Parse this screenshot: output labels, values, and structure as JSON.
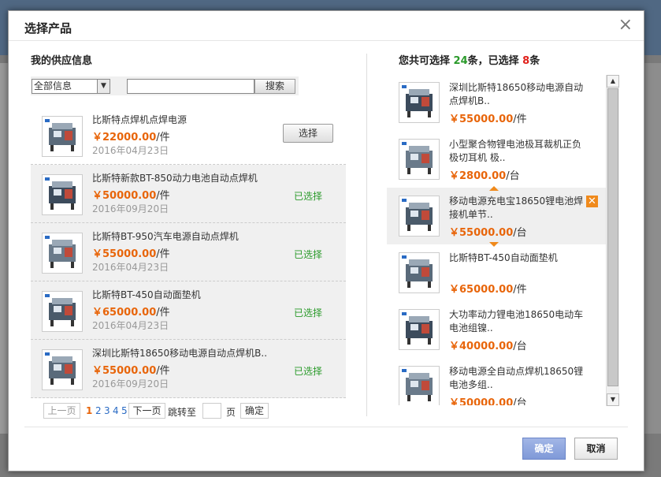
{
  "dialog": {
    "title": "选择产品",
    "close_icon": "close-icon"
  },
  "left": {
    "section_title": "我的供应信息",
    "filter": {
      "selected": "全部信息",
      "search_value": "",
      "search_button": "搜索"
    },
    "products": [
      {
        "name": "比斯特点焊机点焊电源",
        "currency": "￥",
        "price": "22000.00",
        "unit": "/件",
        "date": "2016年04月23日",
        "action": "选择",
        "selected": false
      },
      {
        "name": "比斯特新款BT-850动力电池自动点焊机",
        "currency": "￥",
        "price": "50000.00",
        "unit": "/件",
        "date": "2016年09月20日",
        "action": "已选择",
        "selected": true
      },
      {
        "name": "比斯特BT-950汽车电源自动点焊机",
        "currency": "￥",
        "price": "55000.00",
        "unit": "/件",
        "date": "2016年04月23日",
        "action": "已选择",
        "selected": true
      },
      {
        "name": "比斯特BT-450自动面垫机",
        "currency": "￥",
        "price": "65000.00",
        "unit": "/件",
        "date": "2016年04月23日",
        "action": "已选择",
        "selected": true
      },
      {
        "name": "深圳比斯特18650移动电源自动点焊机B..",
        "currency": "￥",
        "price": "55000.00",
        "unit": "/件",
        "date": "2016年09月20日",
        "action": "已选择",
        "selected": true
      }
    ],
    "pager": {
      "prev": "上一页",
      "pages": [
        "1",
        "2",
        "3",
        "4",
        "5"
      ],
      "current": "1",
      "next": "下一页",
      "jump_label": "跳转至",
      "page_unit": "页",
      "confirm": "确定",
      "jump_value": ""
    }
  },
  "right": {
    "count": {
      "prefix": "您共可选择 ",
      "total": "24",
      "mid1": "条，已选择 ",
      "chosen": "8",
      "suffix": "条"
    },
    "items": [
      {
        "name": "深圳比斯特18650移动电源自动点焊机B..",
        "currency": "￥",
        "price": "55000.00",
        "unit": "/件"
      },
      {
        "name": "小型聚合物锂电池极耳裁机正负极切耳机 极..",
        "currency": "￥",
        "price": "2800.00",
        "unit": "/台"
      },
      {
        "name": "移动电源充电宝18650锂电池焊接机单节..",
        "currency": "￥",
        "price": "55000.00",
        "unit": "/台",
        "active": true
      },
      {
        "name": "比斯特BT-450自动面垫机",
        "currency": "￥",
        "price": "65000.00",
        "unit": "/件"
      },
      {
        "name": "大功率动力锂电池18650电动车电池组镍..",
        "currency": "￥",
        "price": "40000.00",
        "unit": "/台"
      },
      {
        "name": "移动电源全自动点焊机18650锂电池多组..",
        "currency": "￥",
        "price": "50000.00",
        "unit": "/台"
      }
    ],
    "delete_glyph": "✕"
  },
  "footer": {
    "ok": "确定",
    "cancel": "取消"
  },
  "colors": {
    "price": "#e8650a",
    "chosen": "#2a9a2a",
    "count_total": "#2a9a2a",
    "count_chosen": "#e0201a",
    "accent": "#f08a1c",
    "ok_button": "#7f99d8"
  }
}
